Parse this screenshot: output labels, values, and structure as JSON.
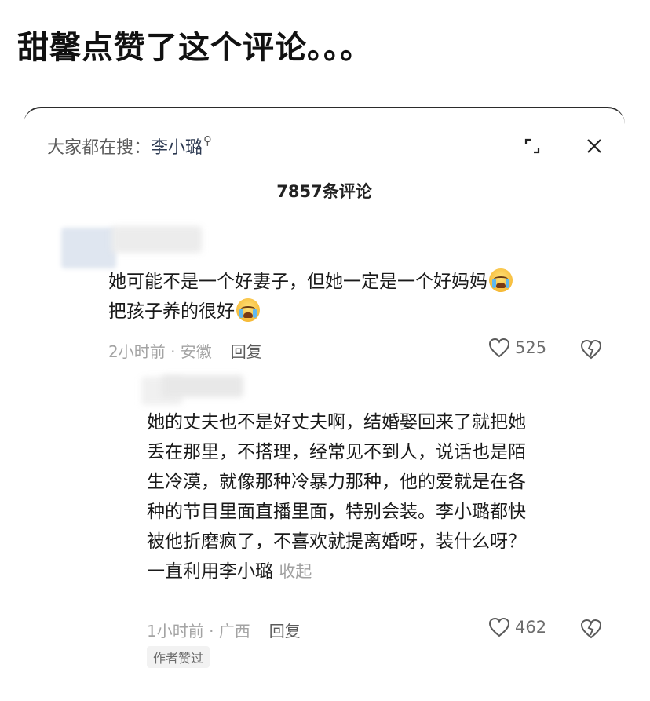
{
  "headline": "甜馨点赞了这个评论。。。",
  "panel": {
    "search_prefix": "大家都在搜：",
    "search_keyword": "李小璐",
    "comment_count": "7857条评论"
  },
  "comments": [
    {
      "line1": "她可能不是一个好妻子，但她一定是一个好妈妈",
      "line2": "把孩子养的很好",
      "meta": "2小时前 · 安徽",
      "reply_label": "回复",
      "likes": "525"
    },
    {
      "lines": [
        "她的丈夫也不是好丈夫啊，结婚娶回来了就把她",
        "丢在那里，不搭理，经常见不到人，说话也是陌",
        "生冷漠，就像那种冷暴力那种，他的爱就是在各",
        "种的节目里面直播里面，特别会装。李小璐都快",
        "被他折磨疯了，不喜欢就提离婚呀，装什么呀？"
      ],
      "last_line": "一直利用李小璐",
      "collapse_label": "收起",
      "meta": "1小时前 · 广西",
      "reply_label": "回复",
      "likes": "462",
      "badge": "作者赞过"
    }
  ],
  "icons": {
    "search": "magnifier-icon",
    "expand": "expand-icon",
    "close": "close-icon",
    "like": "heart-icon",
    "dislike": "broken-heart-icon",
    "emoji": "crying-face-icon"
  },
  "colors": {
    "keyword": "#2d3a52",
    "meta": "#a3a3a3",
    "text": "#1a1a1a"
  }
}
